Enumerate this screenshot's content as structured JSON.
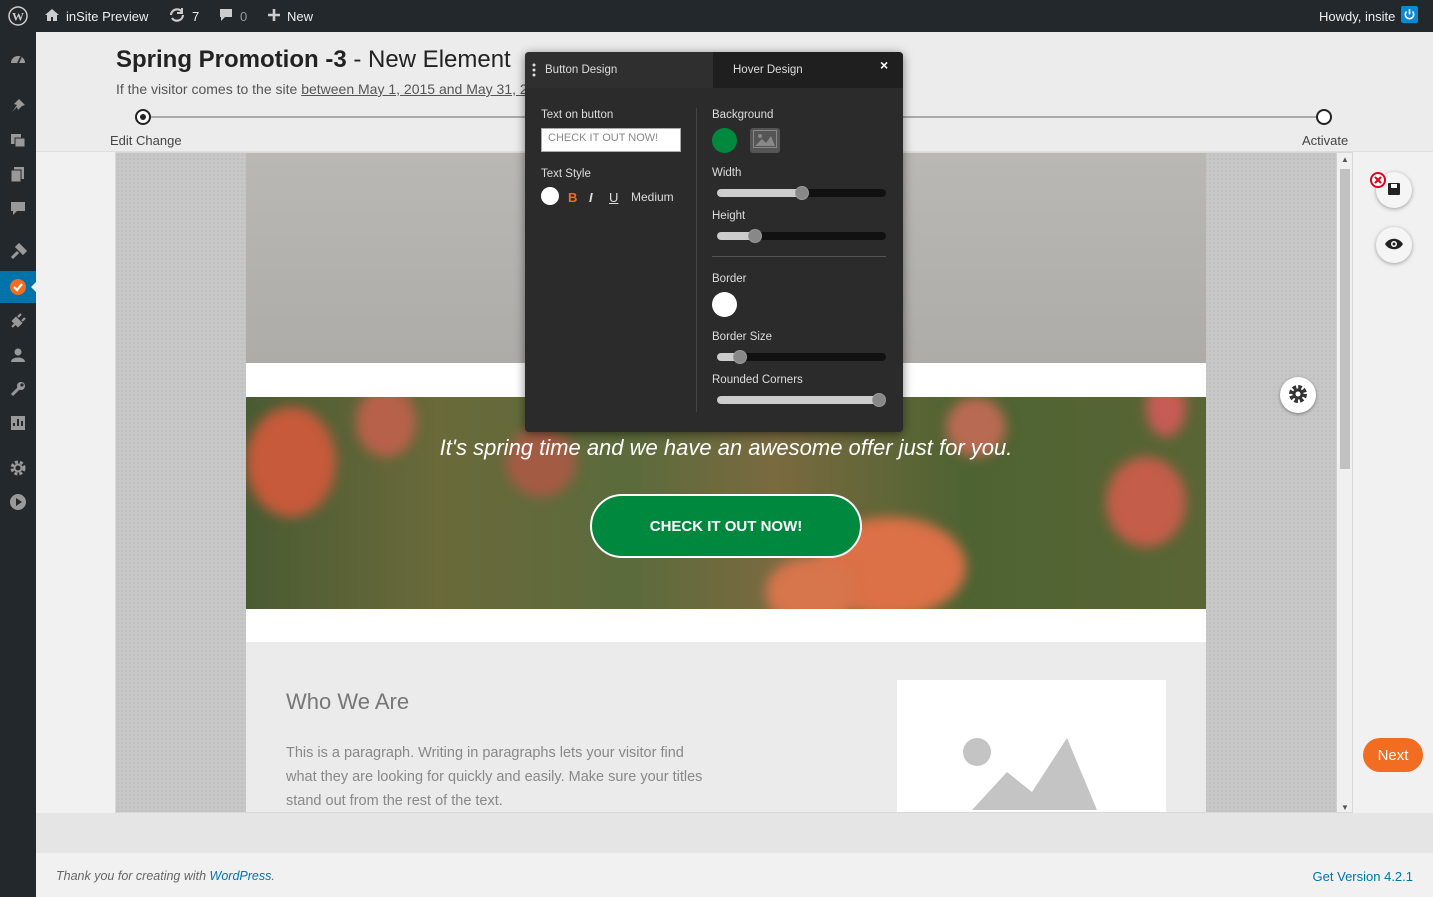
{
  "adminbar": {
    "site_name": "inSite Preview",
    "updates_count": "7",
    "comments_count": "0",
    "new_label": "New",
    "greeting": "Howdy, insite"
  },
  "sidebar": {
    "items": [
      "dashboard-icon",
      "pin-icon",
      "media-icon",
      "pages-icon",
      "comments-icon",
      "appearance-icon",
      "insite-icon",
      "plugins-icon",
      "users-icon",
      "tools-icon",
      "settings-icon",
      "gear-icon",
      "play-icon"
    ]
  },
  "header": {
    "title_bold": "Spring Promotion -3",
    "title_rest": " - New Element",
    "condition_prefix": "If the visitor comes to the site ",
    "condition_link": "between May 1, 2015 and May 31, 2",
    "steps": [
      "Edit Change",
      "Activate"
    ]
  },
  "preview": {
    "promo_text": "It's spring time and we have an awesome offer just for you.",
    "cta_label": "CHECK IT OUT NOW!",
    "section_title": "Who We Are",
    "section_text": "This is a paragraph. Writing in paragraphs lets your visitor find what they are looking for quickly and easily. Make sure your titles stand out from the rest of the text."
  },
  "panel": {
    "tab_button_design": "Button Design",
    "tab_hover_design": "Hover Design",
    "close": "×",
    "text_on_button_label": "Text on button",
    "text_on_button_value": "CHECK IT OUT NOW!",
    "text_style_label": "Text Style",
    "style_bold": "B",
    "style_italic": "I",
    "style_underline": "U",
    "font_weight": "Medium",
    "background_label": "Background",
    "width_label": "Width",
    "height_label": "Height",
    "border_label": "Border",
    "border_size_label": "Border Size",
    "rounded_corners_label": "Rounded Corners",
    "sliders": {
      "width": 0.5,
      "height": 0.2,
      "border_size": 0.1,
      "rounded_corners": 1.0
    },
    "colors": {
      "background": "#00893e",
      "border": "#ffffff",
      "text": "#ffffff"
    }
  },
  "actions": {
    "next_label": "Next"
  },
  "footer": {
    "thanks_prefix": "Thank you for creating with ",
    "wp_link": "WordPress",
    "thanks_suffix": ".",
    "version": "Get Version 4.2.1"
  }
}
